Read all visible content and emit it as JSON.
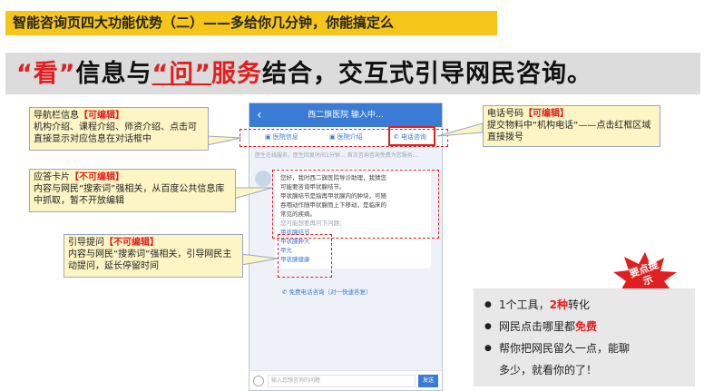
{
  "title": "智能咨询页四大功能优势（二）——多给你几分钟，你能搞定么",
  "headline": {
    "part1": "“看”",
    "part2": "信息与",
    "part3": "“问”",
    "part4": "服务",
    "part5": "结合，交互式引导网民咨询。"
  },
  "phone": {
    "header_title": "西二旗医院  输入中…",
    "nav_items": [
      "医院信息",
      "医院介绍",
      "电话咨询"
    ],
    "note": "医生在线服务，医生回复时间1分钟… 首次咨询咨询免费为您服务…",
    "bubble_lines": [
      "您好，我时西二旗医院导诊助理，我猜您",
      "可能要咨询甲状腺结节。",
      "甲状腺结节是指再甲状腺内的肿块，可随",
      "吞咽动作随甲状腺而上下移动，是临床的",
      "常见的疾病。"
    ],
    "bubble_hint": "您可能想要再问下问题：",
    "questions": [
      "甲状腺结节",
      "甲状腺肿大",
      "甲亢",
      "甲状腺健康"
    ],
    "call_text": "免费电话咨询（对一快速答复）",
    "input_placeholder": "输入您想咨询的问题",
    "send_label": "发送"
  },
  "callouts": {
    "nav": {
      "title": "导航栏信息",
      "tag": "【可编辑】",
      "body": "机构介绍、课程介绍、师资介绍、点击可直接显示对应信息在对话框中"
    },
    "phone": {
      "title": "电话号码",
      "tag": "【可编辑】",
      "body": "提交物料中“机构电话”——点击红框区域直接拨号"
    },
    "card": {
      "title": "应答卡片",
      "tag": "【不可编辑】",
      "body": "内容与网民“搜索词”强相关，从百度公共信息库中抓取，暂不开放编辑"
    },
    "guide": {
      "title": "引导提问",
      "tag": "【不可编辑】",
      "body": "内容与网民“搜索词”强相关，引导网民主动提问，延长停留时间"
    },
    "colors": {
      "fill": "#fdf5c4",
      "border": "#9aa7c3",
      "accent": "#e02020"
    }
  },
  "badge": "要点提示",
  "points": [
    {
      "pre": "1个工具，",
      "red": "2种",
      "post": "转化"
    },
    {
      "pre": "网民点击哪里都",
      "red": "免费",
      "post": ""
    },
    {
      "pre": "帮你把网民留久一点，能聊",
      "red": "",
      "post": ""
    },
    {
      "pre": "多少，就看你的了！",
      "red": "",
      "post": ""
    }
  ],
  "theme": {
    "title_bg": "#f5c518",
    "red": "#e02020",
    "blue": "#3a7bd5"
  }
}
